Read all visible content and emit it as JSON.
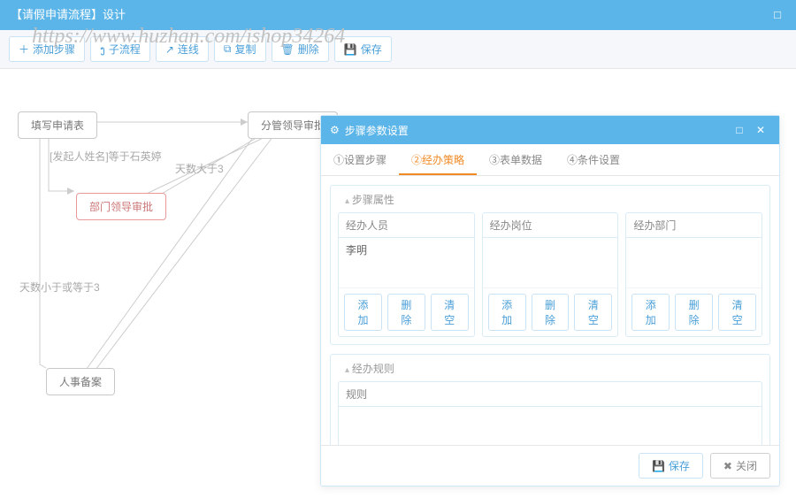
{
  "header": {
    "title": "【请假申请流程】设计"
  },
  "watermark": "https://www.huzhan.com/ishop34264",
  "toolbar": {
    "add_step": "添加步骤",
    "sub_flow": "子流程",
    "connect": "连线",
    "copy": "复制",
    "delete": "删除",
    "save": "保存"
  },
  "flow": {
    "nodes": {
      "fill_form": "填写申请表",
      "division_approval": "分管领导审批",
      "dept_approval": "部门领导审批",
      "hr_record": "人事备案"
    },
    "edge_labels": {
      "initiator_name": "[发起人姓名]等于石英婷",
      "days_gt3": "天数大于3",
      "days_lte3": "天数小于或等于3"
    }
  },
  "modal": {
    "title": "步骤参数设置",
    "tabs": [
      "①设置步骤",
      "②经办策略",
      "③表单数据",
      "④条件设置"
    ],
    "active_tab_index": 1,
    "section_step_props": "步骤属性",
    "section_rules": "经办规则",
    "cols": {
      "person": {
        "label": "经办人员",
        "value": "李明"
      },
      "position": {
        "label": "经办岗位",
        "value": ""
      },
      "dept": {
        "label": "经办部门",
        "value": ""
      }
    },
    "rule_col_label": "规则",
    "btns": {
      "add": "添加",
      "del": "删除",
      "clear": "清空"
    },
    "footer": {
      "save": "保存",
      "close": "关闭"
    }
  }
}
